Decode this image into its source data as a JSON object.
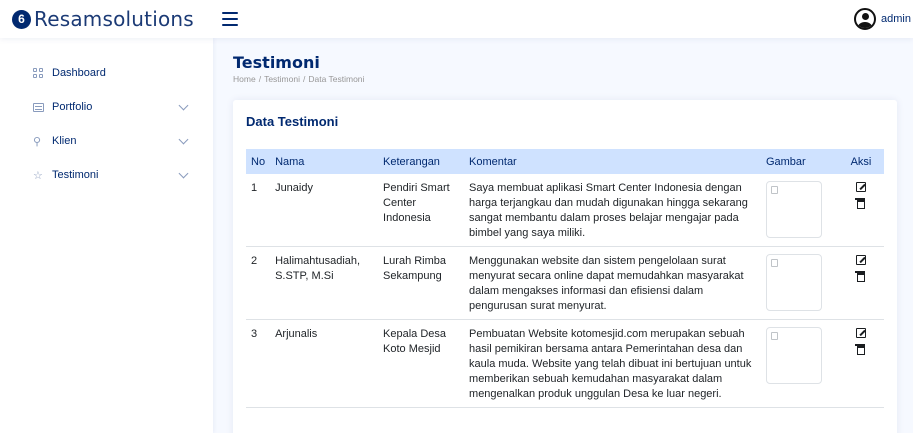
{
  "header": {
    "logo_mark": "6",
    "app_name": "Resamsolutions",
    "user_name": "admin"
  },
  "sidebar": {
    "items": [
      {
        "label": "Dashboard",
        "icon": "grid-icon",
        "has_chevron": false
      },
      {
        "label": "Portfolio",
        "icon": "list-icon",
        "has_chevron": true
      },
      {
        "label": "Klien",
        "icon": "person-icon",
        "has_chevron": true
      },
      {
        "label": "Testimoni",
        "icon": "star-icon",
        "has_chevron": true
      }
    ]
  },
  "page": {
    "title": "Testimoni",
    "breadcrumb": [
      "Home",
      "Testimoni",
      "Data Testimoni"
    ]
  },
  "card": {
    "title": "Data Testimoni",
    "columns": [
      "No",
      "Nama",
      "Keterangan",
      "Komentar",
      "Gambar",
      "Aksi"
    ],
    "rows": [
      {
        "no": "1",
        "nama": "Junaidy",
        "keterangan": "Pendiri Smart Center Indonesia",
        "komentar": "Saya membuat aplikasi Smart Center Indonesia dengan harga terjangkau dan mudah digunakan hingga sekarang sangat membantu dalam proses belajar mengajar pada bimbel yang saya miliki."
      },
      {
        "no": "2",
        "nama": "Halimahtusadiah, S.STP, M.Si",
        "keterangan": "Lurah Rimba Sekampung",
        "komentar": "Menggunakan website dan sistem pengelolaan surat menyurat secara online dapat memudahkan masyarakat dalam mengakses informasi dan efisiensi dalam pengurusan surat menyurat."
      },
      {
        "no": "3",
        "nama": "Arjunalis",
        "keterangan": "Kepala Desa Koto Mesjid",
        "komentar": "Pembuatan Website kotomesjid.com merupakan sebuah hasil pemikiran bersama antara Pemerintahan desa dan kaula muda. Website yang telah dibuat ini bertujuan untuk memberikan sebuah kemudahan masyarakat dalam mengenalkan produk unggulan Desa ke luar negeri."
      }
    ]
  }
}
